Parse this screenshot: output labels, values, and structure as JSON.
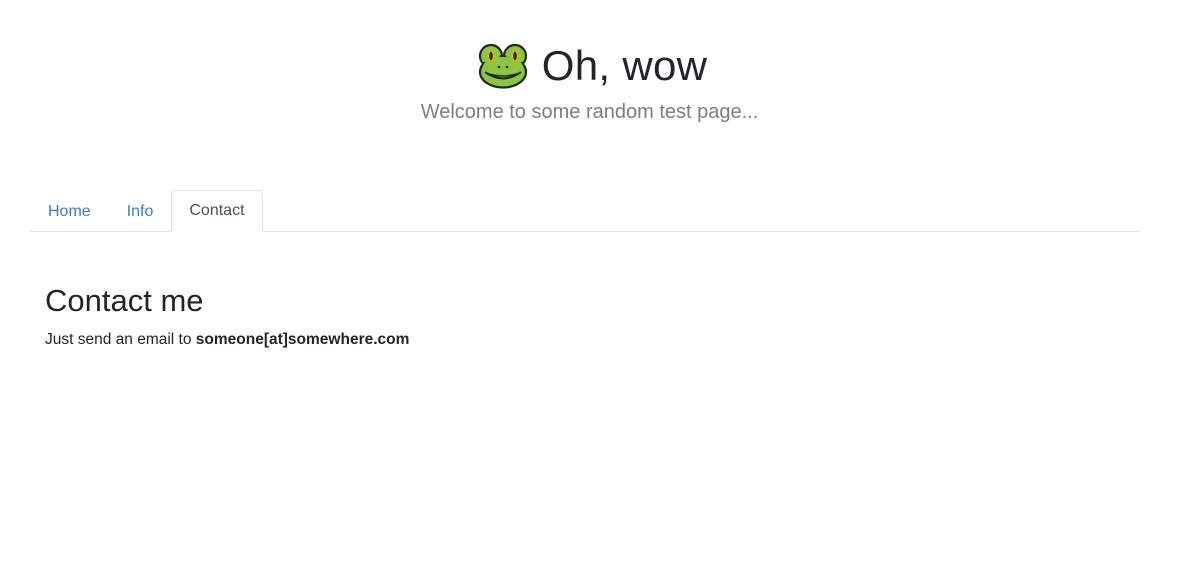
{
  "header": {
    "title": "Oh, wow",
    "subtitle": "Welcome to some random test page...",
    "logo_icon": "frog-face-icon"
  },
  "nav": {
    "tabs": [
      {
        "label": "Home",
        "active": false
      },
      {
        "label": "Info",
        "active": false
      },
      {
        "label": "Contact",
        "active": true
      }
    ]
  },
  "main": {
    "heading": "Contact me",
    "text_prefix": "Just send an email to ",
    "email": "someone[at]somewhere.com"
  },
  "colors": {
    "link": "#3a7bd5",
    "text": "#212529",
    "muted": "#7a7f85",
    "border": "#dee2e6"
  }
}
